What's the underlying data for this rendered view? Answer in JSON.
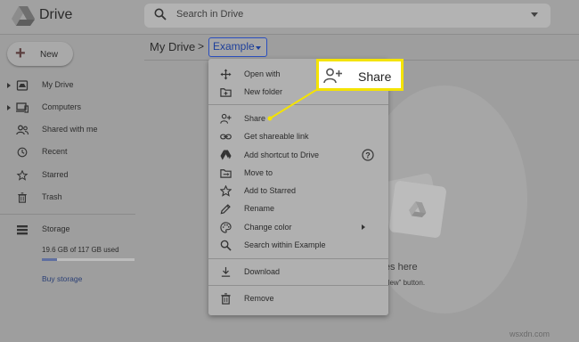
{
  "app": {
    "title": "Drive"
  },
  "search": {
    "placeholder": "Search in Drive"
  },
  "sidebar": {
    "new_label": "New",
    "items": [
      {
        "label": "My Drive",
        "icon": "my-drive-icon",
        "expandable": true
      },
      {
        "label": "Computers",
        "icon": "computers-icon",
        "expandable": true
      },
      {
        "label": "Shared with me",
        "icon": "shared-with-me-icon",
        "expandable": false
      },
      {
        "label": "Recent",
        "icon": "clock-icon",
        "expandable": false
      },
      {
        "label": "Starred",
        "icon": "star-icon",
        "expandable": false
      },
      {
        "label": "Trash",
        "icon": "trash-icon",
        "expandable": false
      }
    ],
    "storage": {
      "label": "Storage",
      "used_text": "19.6 GB of 117 GB used",
      "used_fraction": 0.168,
      "buy_label": "Buy storage"
    }
  },
  "breadcrumb": {
    "root": "My Drive",
    "separator": ">",
    "current": "Example"
  },
  "empty_state": {
    "title": "rop files here",
    "subtitle": "e the “New” button."
  },
  "context_menu": {
    "groups": [
      [
        {
          "label": "Open with",
          "icon": "open-with-icon",
          "submenu": false
        },
        {
          "label": "New folder",
          "icon": "new-folder-icon",
          "submenu": false
        }
      ],
      [
        {
          "label": "Share",
          "icon": "share-icon",
          "submenu": false
        },
        {
          "label": "Get shareable link",
          "icon": "link-icon",
          "submenu": false
        },
        {
          "label": "Add shortcut to Drive",
          "icon": "shortcut-icon",
          "submenu": false,
          "help": true
        },
        {
          "label": "Move to",
          "icon": "move-to-icon",
          "submenu": false
        },
        {
          "label": "Add to Starred",
          "icon": "star-icon",
          "submenu": false
        },
        {
          "label": "Rename",
          "icon": "rename-icon",
          "submenu": false
        },
        {
          "label": "Change color",
          "icon": "palette-icon",
          "submenu": true
        },
        {
          "label": "Search within Example",
          "icon": "search-icon",
          "submenu": false
        }
      ],
      [
        {
          "label": "Download",
          "icon": "download-icon",
          "submenu": false
        }
      ],
      [
        {
          "label": "Remove",
          "icon": "trash-icon",
          "submenu": false
        }
      ]
    ]
  },
  "callout": {
    "label": "Share",
    "icon": "share-icon",
    "highlight_color": "#f4e300"
  },
  "watermark": "wsxdn.com",
  "colors": {
    "accent_blue": "#2a4fbf",
    "overlay_gray": "#9e9e9e"
  }
}
